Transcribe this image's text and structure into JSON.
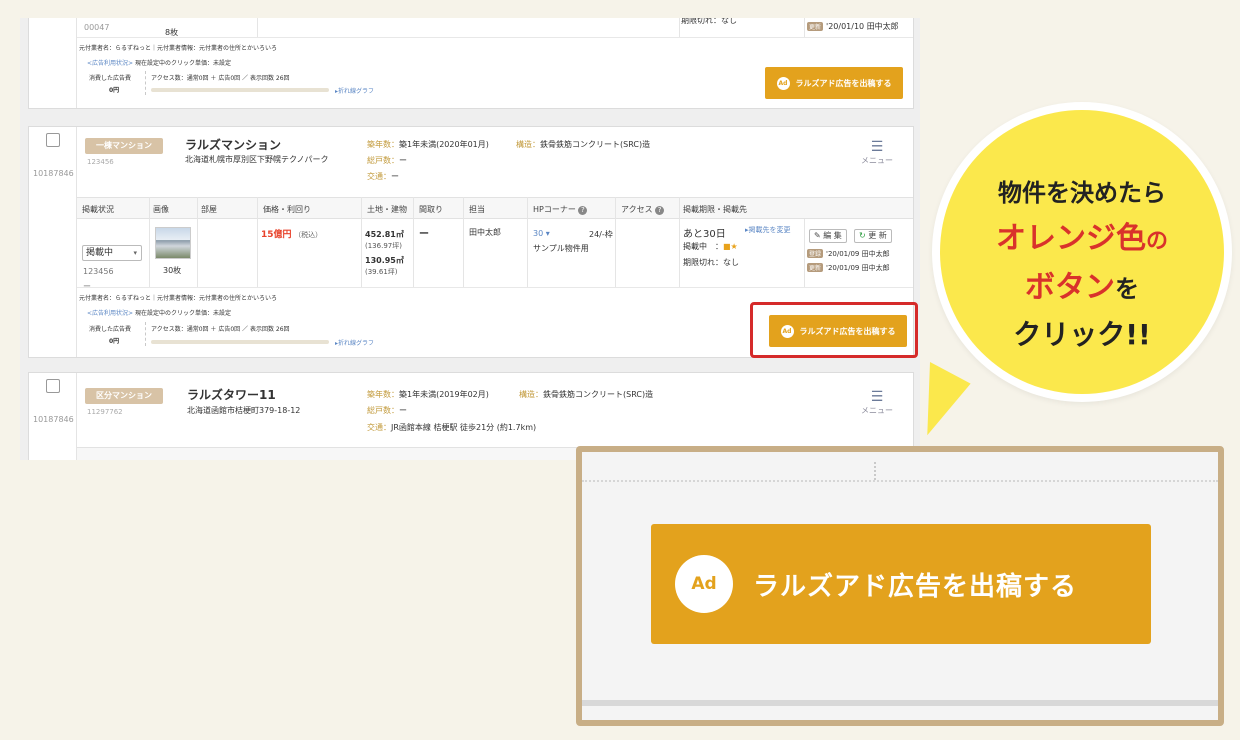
{
  "card1": {
    "code": "00047",
    "photo_count": "8枚",
    "expiry": "期限切れ：なし",
    "update_badge": "更新",
    "update_text": "'20/01/10 田中太郎",
    "agent_name": "元付業者名：らるずねっと",
    "agent_info": "元付業者情報：元付業者の住所とかいろいろ",
    "ad_status_link": "<広告利用状況>",
    "click_price": "現在設定中のクリック単価：未設定",
    "ad_cost_label": "消費した広告費",
    "ad_cost_value": "0円",
    "access_text": "アクセス数：通常0回 ＋ 広告0回 ／ 表示回数 26回",
    "graph_link": "折れ線グラフ",
    "ad_button": "ラルズアド広告を出稿する"
  },
  "card2": {
    "row_id": "10187846",
    "type_tag": "一棟マンション",
    "property_id": "123456",
    "name": "ラルズマンション",
    "address": "北海道札幌市厚別区下野幌テクノパーク",
    "built_label": "築年数：",
    "built_value": "築1年未満(2020年01月)",
    "structure_label": "構造：",
    "structure_value": "鉄骨鉄筋コンクリート(SRC)造",
    "units_label": "総戸数：",
    "units_value": "ー",
    "traffic_label": "交通：",
    "traffic_value": "ー",
    "menu": "メニュー",
    "headers": [
      "掲載状況",
      "画像",
      "部屋",
      "価格・利回り",
      "土地・建物",
      "間取り",
      "担当",
      "HPコーナー",
      "アクセス",
      "掲載期限・掲載先"
    ],
    "status_select": "掲載中",
    "status_id": "123456",
    "status_dash": "ー",
    "photo_count": "30枚",
    "price": "15億円",
    "price_tax": "（税込）",
    "land_area": "452.81㎡",
    "land_tsubo": "(136.97坪)",
    "building_area": "130.95㎡",
    "building_tsubo": "(39.61坪)",
    "layout": "ー",
    "staff": "田中太郎",
    "hp_num": "30",
    "hp_count": "24/-枠",
    "hp_name": "サンプル物件用",
    "period": "あと30日",
    "change_link": "掲載先を変更",
    "listing": "掲載中　：",
    "expiry": "期限切れ：なし",
    "edit": "編 集",
    "refresh": "更 新",
    "reg_badge": "登録",
    "reg_text": "'20/01/09 田中太郎",
    "upd_badge": "更新",
    "upd_text": "'20/01/09 田中太郎",
    "agent_name": "元付業者名：らるずねっと",
    "agent_info": "元付業者情報：元付業者の住所とかいろいろ",
    "ad_status_link": "<広告利用状況>",
    "click_price": "現在設定中のクリック単価：未設定",
    "ad_cost_label": "消費した広告費",
    "ad_cost_value": "0円",
    "access_text": "アクセス数：通常0回 ＋ 広告0回 ／ 表示回数 26回",
    "graph_link": "折れ線グラフ",
    "ad_button": "ラルズアド広告を出稿する"
  },
  "card3": {
    "row_id": "10187846",
    "type_tag": "区分マンション",
    "property_id": "11297762",
    "name": "ラルズタワー11",
    "address": "北海道函館市桔梗町379-18-12",
    "built_label": "築年数：",
    "built_value": "築1年未満(2019年02月)",
    "structure_label": "構造：",
    "structure_value": "鉄骨鉄筋コンクリート(SRC)造",
    "units_label": "総戸数：",
    "units_value": "ー",
    "traffic_label": "交通：",
    "traffic_value": "JR函館本線 桔梗駅 徒歩21分 (約1.7km)",
    "menu": "メニュー"
  },
  "zoom": {
    "icon": "Ad",
    "button": "ラルズアド広告を出稿する"
  },
  "bubble": {
    "line1": "物件を決めたら",
    "line2_red": "オレンジ色",
    "line2_suffix": "の",
    "line3_red": "ボタン",
    "line3_suffix": "を",
    "line4": "クリック!!"
  },
  "colors": {
    "accent_orange": "#e3a21d",
    "highlight_red": "#d52a2a",
    "bubble_yellow": "#fbe84c",
    "frame_tan": "#c8ae86"
  }
}
